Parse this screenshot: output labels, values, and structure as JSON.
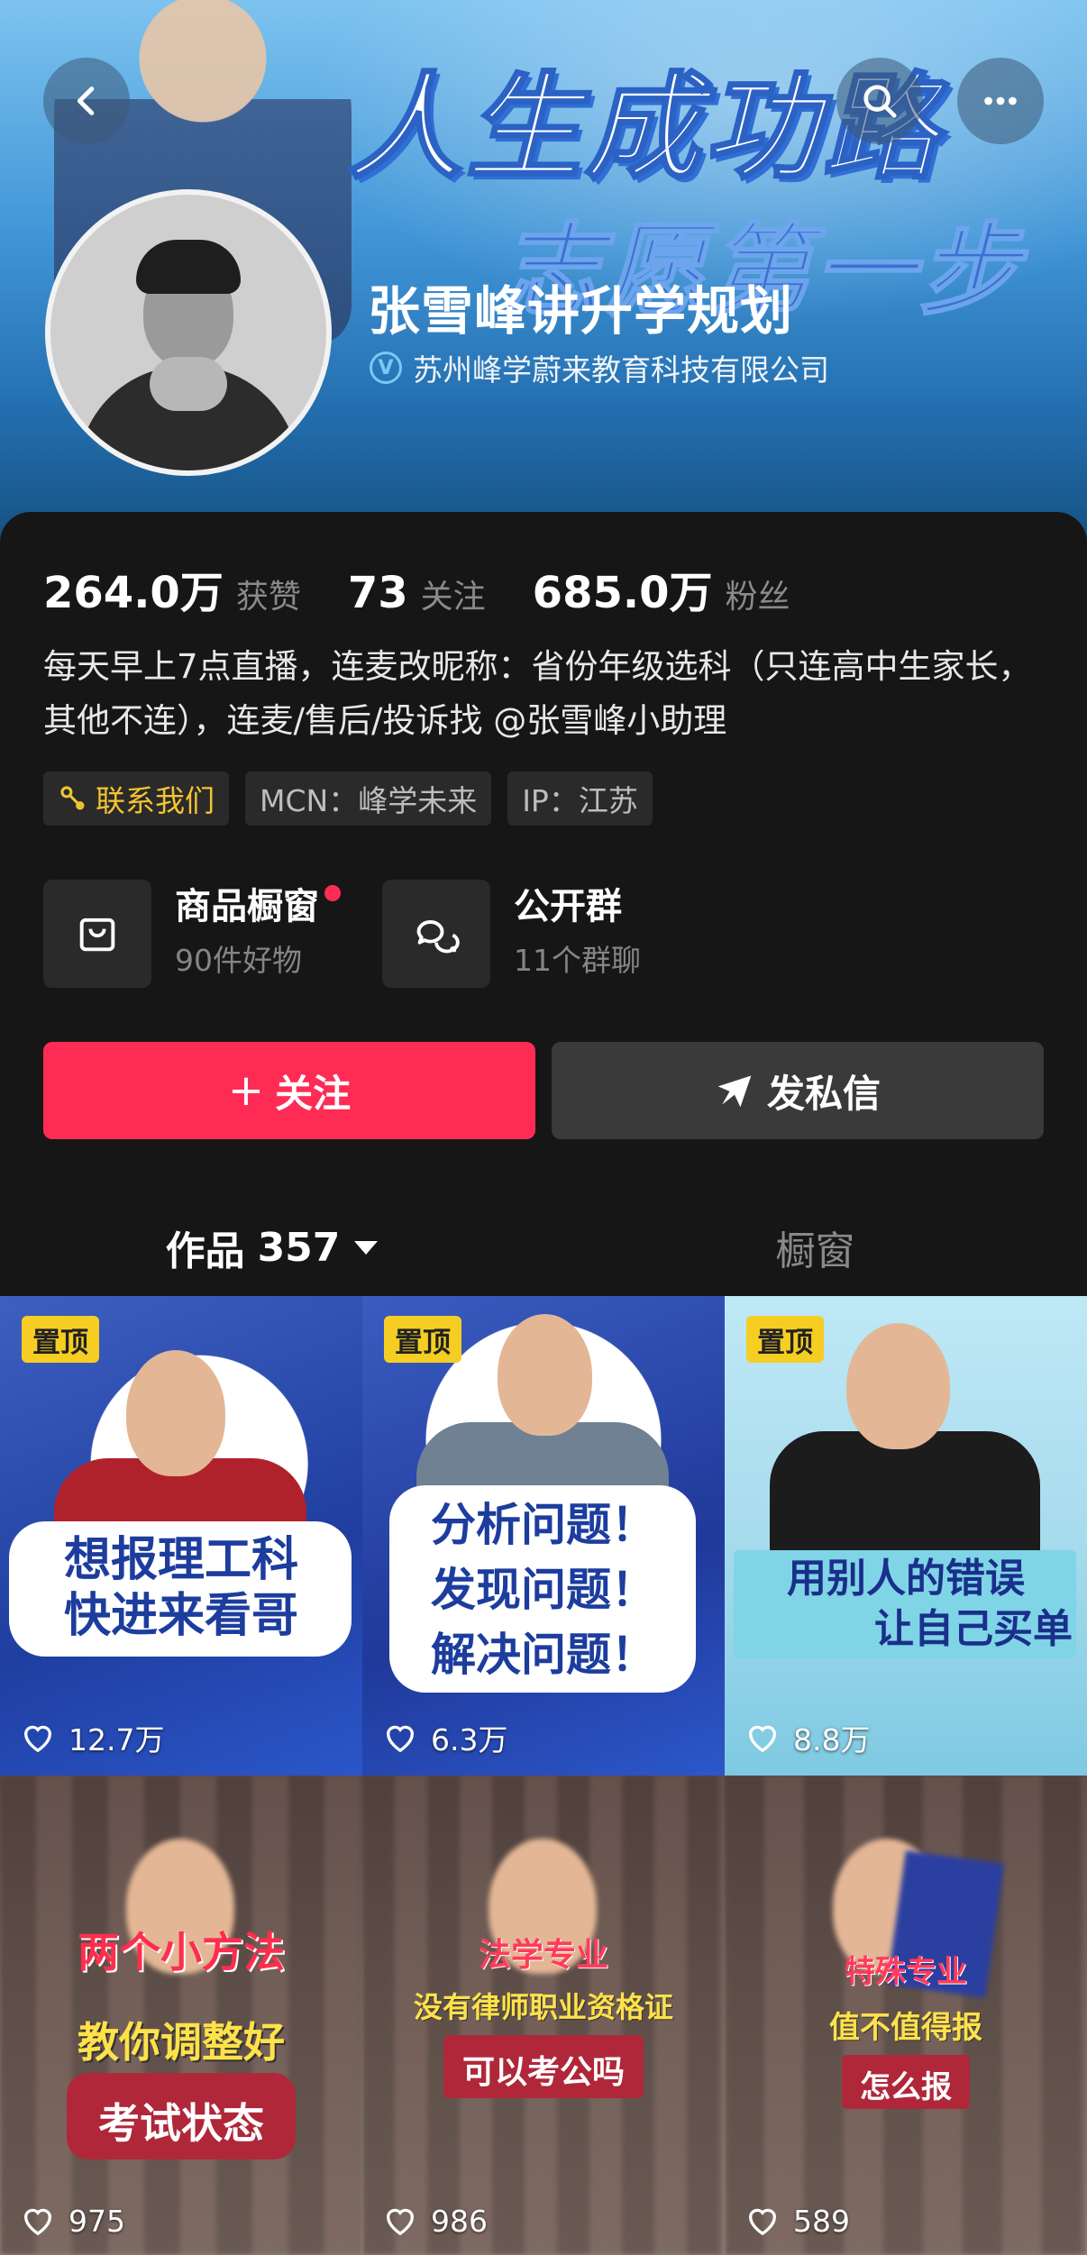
{
  "header": {
    "banner_line1": "人生成功路",
    "banner_line2": "志愿第一步",
    "back_icon": "chevron-left-icon",
    "search_icon": "search-icon",
    "more_icon": "more-horizontal-icon"
  },
  "profile": {
    "name": "张雪峰讲升学规划",
    "company": "苏州峰学蔚来教育科技有限公司",
    "verified_icon": "verified-v-icon"
  },
  "stats": {
    "likes_value": "264.0万",
    "likes_label": "获赞",
    "following_value": "73",
    "following_label": "关注",
    "followers_value": "685.0万",
    "followers_label": "粉丝"
  },
  "bio": "每天早上7点直播，连麦改昵称：省份年级选科（只连高中生家长，其他不连），连麦/售后/投诉找 @张雪峰小助理",
  "tags": {
    "contact": "联系我们",
    "mcn": "MCN：峰学未来",
    "ip": "IP：江苏"
  },
  "features": {
    "shop_title": "商品橱窗",
    "shop_sub": "90件好物",
    "group_title": "公开群",
    "group_sub": "11个群聊"
  },
  "actions": {
    "follow_label": "关注",
    "message_label": "发私信"
  },
  "tabs": {
    "works_label": "作品",
    "works_count": "357",
    "window_label": "橱窗"
  },
  "videos": [
    {
      "pinned": "置顶",
      "likes": "12.7万",
      "cover_line1": "想报理工科",
      "cover_line2": "快进来看哥"
    },
    {
      "pinned": "置顶",
      "likes": "6.3万",
      "cover_line1": "分析问题！",
      "cover_line2": "发现问题！",
      "cover_line3": "解决问题！"
    },
    {
      "pinned": "置顶",
      "likes": "8.8万",
      "cover_line1": "用别人的错误",
      "cover_line2": "让自己买单"
    },
    {
      "likes": "975",
      "cover_line1": "两个小方法",
      "cover_line2": "教你调整好",
      "cover_line3": "考试状态"
    },
    {
      "likes": "986",
      "cover_line1": "法学专业",
      "cover_line2": "没有律师职业资格证",
      "cover_line3": "可以考公吗"
    },
    {
      "likes": "589",
      "cover_line1": "特殊专业",
      "cover_line2": "值不值得报",
      "cover_line3": "怎么报"
    }
  ],
  "colors": {
    "accent_red": "#fe2c55",
    "tab_underline": "#f2c431",
    "pin_badge": "#f6cd22",
    "background": "#161616"
  }
}
